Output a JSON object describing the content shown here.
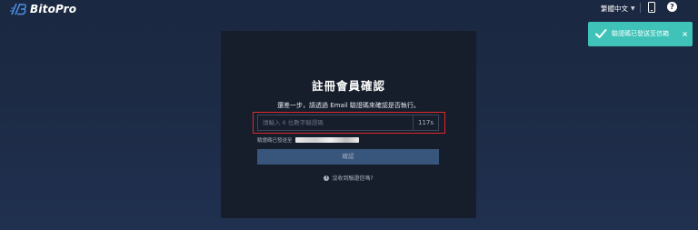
{
  "header": {
    "brand": "BitoPro",
    "language": "繁體中文",
    "icons": {
      "logo": "bitopro-logo-icon",
      "caret": "chevron-down-icon",
      "phone": "mobile-phone-icon",
      "help": "help-circle-icon"
    }
  },
  "toast": {
    "message": "驗證碼已發送至信箱",
    "close": "×",
    "icon": "check-icon",
    "color": "#3fc3b8"
  },
  "card": {
    "title": "註冊會員確認",
    "subtitle": "還差一步，請透過 Email 驗證碼來確認是否執行。",
    "code_input": {
      "value": "",
      "placeholder": "請輸入 6 位數字驗證碼"
    },
    "countdown": "117s",
    "sent_label": "驗證碼已發送至",
    "confirm_label": "確認",
    "no_code_label": "沒收到驗證信嗎?"
  },
  "colors": {
    "background": "#1c2a44",
    "card": "#161d2b",
    "button": "#38557b",
    "highlight": "#e0262b"
  }
}
